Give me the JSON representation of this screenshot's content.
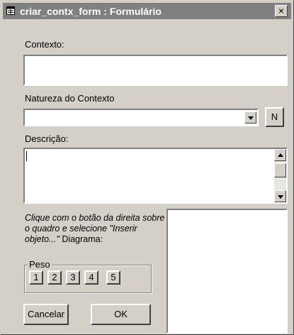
{
  "window": {
    "title": "criar_contx_form : Formulário",
    "close_glyph": "×"
  },
  "icons": {
    "title": "form-icon",
    "close": "close-icon",
    "dropdown": "chevron-down-icon",
    "scroll_up": "arrow-up-icon",
    "scroll_down": "arrow-down-icon"
  },
  "fields": {
    "contexto_label": "Contexto:",
    "contexto_value": "",
    "natureza_label": "Natureza do Contexto",
    "natureza_value": "",
    "new_button_label": "N",
    "descricao_label": "Descrição:",
    "descricao_value": ""
  },
  "diagram": {
    "hint_italic": "Clique com o botão da direita sobre o quadro e selecione \"Inserir objeto...\"",
    "hint_label": " Diagrama:"
  },
  "peso": {
    "legend": "Peso",
    "options": [
      "1",
      "2",
      "3",
      "4",
      "5"
    ]
  },
  "actions": {
    "cancel_label": "Cancelar",
    "ok_label": "OK"
  },
  "colors": {
    "face": "#d4d0c8",
    "titlebar_inactive": "#808080",
    "field_background": "#ffffff"
  }
}
